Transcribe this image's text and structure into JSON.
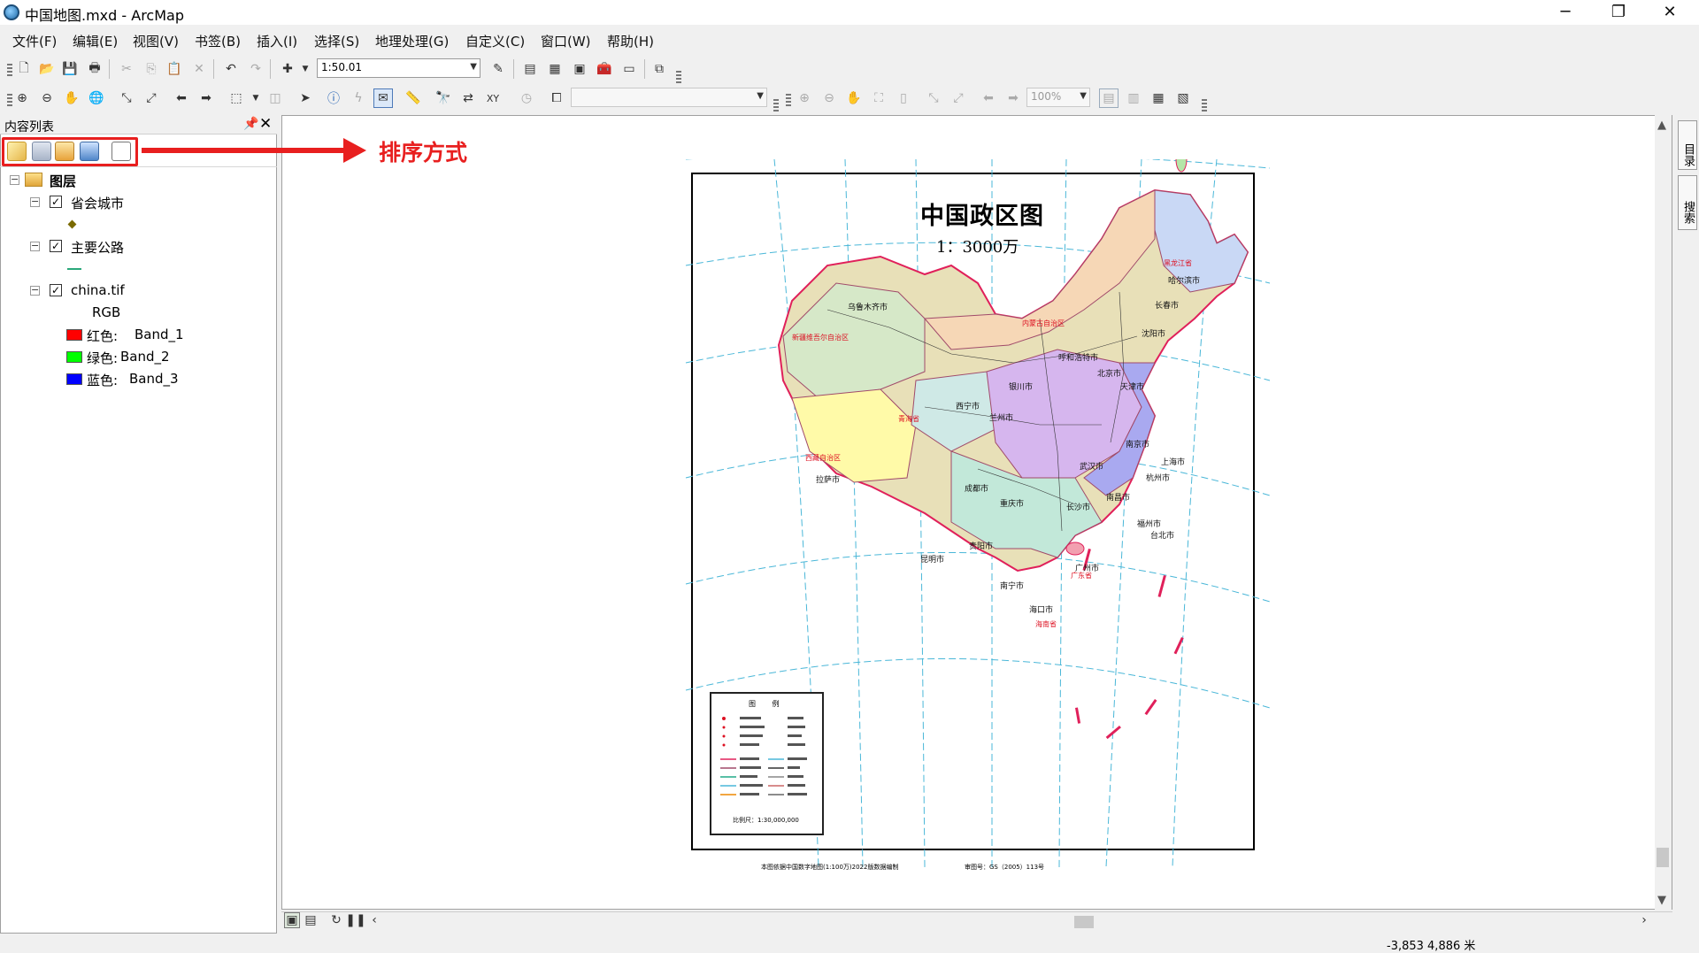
{
  "window": {
    "title": "中国地图.mxd - ArcMap",
    "controls": [
      "─",
      "❐",
      "✕"
    ]
  },
  "menu": [
    "文件(F)",
    "编辑(E)",
    "视图(V)",
    "书签(B)",
    "插入(I)",
    "选择(S)",
    "地理处理(G)",
    "自定义(C)",
    "窗口(W)",
    "帮助(H)"
  ],
  "toolbar": {
    "scale": "1:50.01",
    "zoom_percent": "100%"
  },
  "toc": {
    "title": "内容列表",
    "pin": "𝟰",
    "close": "✕",
    "root": "图层",
    "layers": [
      {
        "name": "省会城市",
        "checked": true
      },
      {
        "name": "主要公路",
        "checked": true
      },
      {
        "name": "china.tif",
        "checked": true,
        "renderer": "RGB",
        "bands": [
          {
            "label": "红色:",
            "band": "Band_1",
            "color": "#ff0000"
          },
          {
            "label": "绿色:",
            "band": "Band_2",
            "color": "#00ff00"
          },
          {
            "label": "蓝色:",
            "band": "Band_3",
            "color": "#0000ff"
          }
        ]
      }
    ]
  },
  "annotation": {
    "label": "排序方式",
    "color": "#e81f1f"
  },
  "side_tabs": [
    "目录",
    "搜索"
  ],
  "map": {
    "title": "中国政区图",
    "scale": "1：3000万",
    "legend_title": "图 例",
    "legend_scale": "比例尺：1:30,000,000",
    "footer_note": "本图依据中国数字地图(1:100万)2022版数据编制",
    "footer_map_no": "审图号：GS（2005）113号",
    "cities": [
      "乌鲁木齐市",
      "哈尔滨市",
      "长春市",
      "沈阳市",
      "呼和浩特市",
      "北京市",
      "天津市",
      "银川市",
      "西宁市",
      "兰州市",
      "拉萨市",
      "成都市",
      "重庆市",
      "武汉市",
      "南京市",
      "上海市",
      "杭州市",
      "长沙市",
      "南昌市",
      "福州市",
      "台北市",
      "贵阳市",
      "昆明市",
      "南宁市",
      "广州市",
      "海口市"
    ],
    "provinces": [
      "新疆维吾尔自治区",
      "西藏自治区",
      "青海省",
      "内蒙古自治区",
      "黑龙江省",
      "广东省",
      "海南省"
    ]
  },
  "status": {
    "coords": "-3,853 4,886 米"
  }
}
